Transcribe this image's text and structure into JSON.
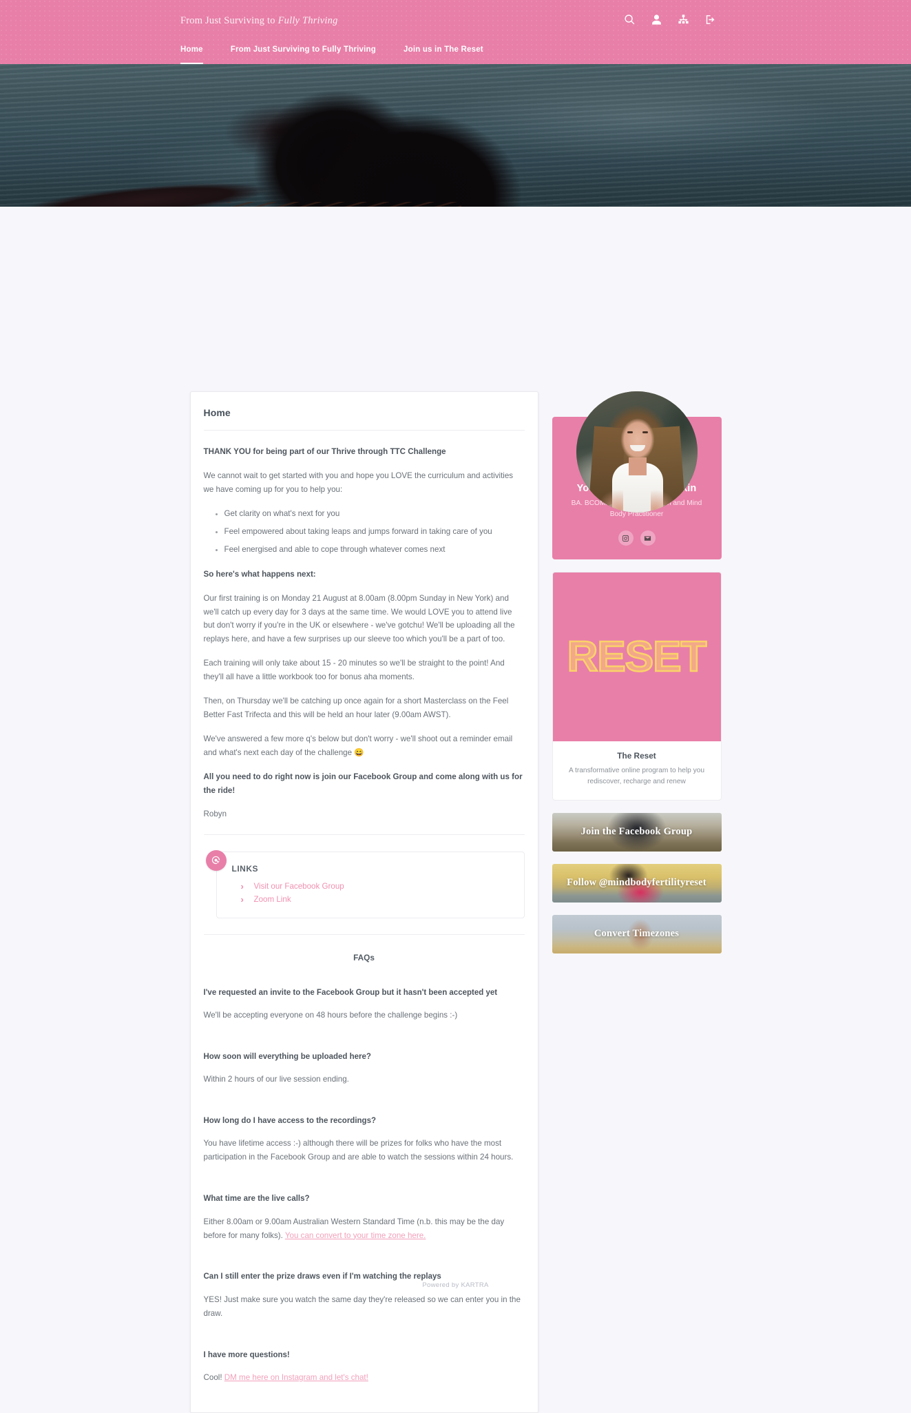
{
  "header": {
    "brand_prefix": "From Just Surviving to ",
    "brand_italic": "Fully Thriving",
    "icons": [
      "search-icon",
      "user-icon",
      "sitemap-icon",
      "logout-icon"
    ],
    "nav": [
      {
        "label": "Home",
        "active": true
      },
      {
        "label": "From Just Surviving to Fully Thriving",
        "active": false
      },
      {
        "label": "Join us in The Reset",
        "active": false
      }
    ]
  },
  "main": {
    "page_title": "Home",
    "intro_heading": "THANK YOU for being part of our Thrive through TTC Challenge",
    "intro_paragraph": "We cannot wait to get started with you and hope you LOVE the curriculum and activities we have coming up for you to help you:",
    "bullets": [
      "Get clarity on what's next for you",
      "Feel empowered about taking leaps and jumps forward in taking care of you",
      "Feel energised and able to cope through whatever comes next"
    ],
    "next_heading": "So here's what happens next:",
    "paragraphs": [
      "Our first training is on Monday 21 August at 8.00am (8.00pm Sunday in New York) and we'll catch up every day for 3 days at the same time. We would LOVE you to attend live but don't worry if you're in the UK or elsewhere - we've gotchu! We'll be uploading all the replays here, and have a few surprises up our sleeve too which you'll be a part of too.",
      "Each training will only take about 15 - 20 minutes so we'll be straight to the point! And they'll all have a little workbook too for bonus aha moments.",
      "Then, on Thursday we'll be catching up once again for a short Masterclass on the Feel Better Fast Trifecta and this will be held an hour later (9.00am AWST).",
      "We've answered a few more q's below but don't worry - we'll shoot out a reminder email and what's next each day of the challenge 😄"
    ],
    "cta_line": "All you need to do right now is join our Facebook Group and come along with us for the ride!",
    "signature": "Robyn",
    "links_box": {
      "badge_icon": "click-target-icon",
      "title": "LINKS",
      "items": [
        {
          "label": "Visit our Facebook Group"
        },
        {
          "label": "Zoom Link"
        }
      ]
    },
    "faq_title": "FAQs",
    "faqs": [
      {
        "q": "I've requested an invite to the Facebook Group but it hasn't been accepted yet",
        "a": "We'll be accepting everyone on 48 hours before the challenge begins :-)"
      },
      {
        "q": "How soon will everything be uploaded here?",
        "a": "Within 2 hours of our live session ending."
      },
      {
        "q": "How long do I have access to the recordings?",
        "a": "You have lifetime access :-) although there will be prizes for folks who have the most participation in the Facebook Group and are able to watch the sessions within 24 hours."
      },
      {
        "q": "What time are the live calls?",
        "a_pre": "Either 8.00am or 9.00am Australian Western Standard Time (n.b. this may be the day before for many folks). ",
        "a_link": "You can convert to your time zone here.",
        "a_post": ""
      },
      {
        "q": "Can I still enter the prize draws even if I'm watching the replays",
        "a": "YES! Just make sure you watch the same day they're released so we can enter you in the draw."
      },
      {
        "q": "I have more questions!",
        "a_pre": "Cool! ",
        "a_link": "DM me here on Instagram and let's chat!",
        "a_post": ""
      }
    ]
  },
  "sidebar": {
    "host": {
      "name": "Your Host - Robyn Birkin",
      "credentials": "BA. BCOM. Certified Life Coach and Mind Body Practitioner",
      "socials": [
        "instagram-icon",
        "email-icon"
      ]
    },
    "reset": {
      "image_word": "RESET",
      "title": "The Reset",
      "description": "A transformative online program to help you rediscover, recharge and renew"
    },
    "banners": [
      {
        "label": "Join the Facebook Group",
        "style": "fb"
      },
      {
        "label_pre": "Follow ",
        "label_italic": "@",
        "label_post": "mindbodyfertilityreset",
        "style": "ig"
      },
      {
        "label": "Convert Timezones",
        "style": "tz"
      }
    ]
  },
  "footer": {
    "text": "Powered by KARTRA"
  },
  "colors": {
    "brand_pink": "#e87fa8",
    "link_pink": "#f090b0",
    "page_bg": "#f7f7fb",
    "text_body": "#6a7178",
    "text_heading": "#4d555d",
    "reset_outline": "#fbd26a"
  }
}
